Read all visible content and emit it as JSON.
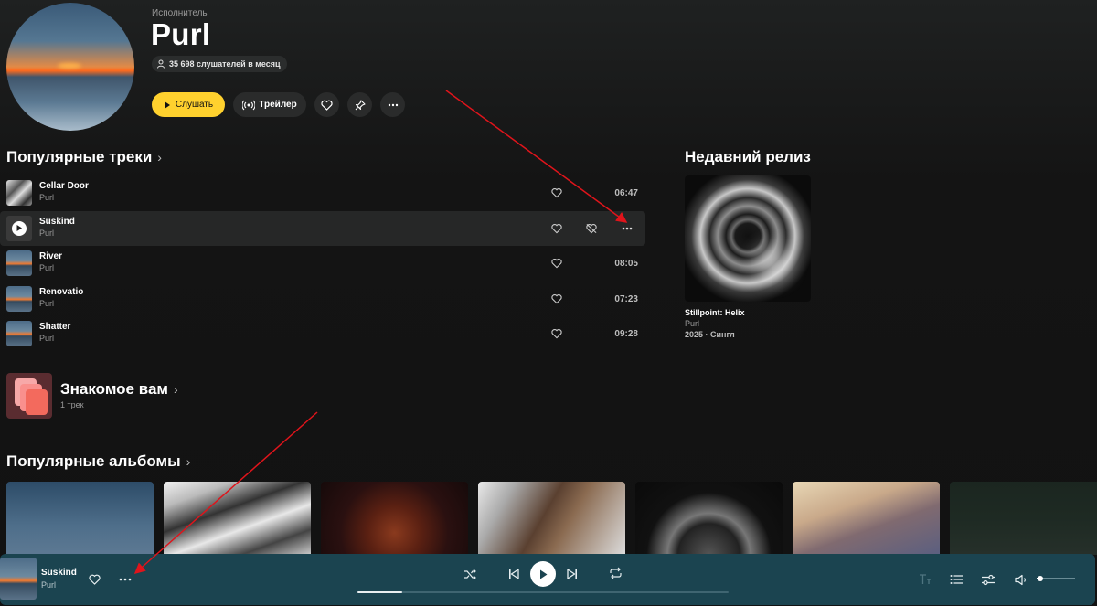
{
  "artist": {
    "kind": "Исполнитель",
    "name": "Purl",
    "listeners": "35 698 слушателей в месяц"
  },
  "actions": {
    "listen_label": "Слушать",
    "trailer_label": "Трейлер"
  },
  "popular_tracks": {
    "title": "Популярные треки",
    "items": [
      {
        "title": "Cellar Door",
        "artist": "Purl",
        "duration": "06:47"
      },
      {
        "title": "Suskind",
        "artist": "Purl",
        "duration": ""
      },
      {
        "title": "River",
        "artist": "Purl",
        "duration": "08:05"
      },
      {
        "title": "Renovatio",
        "artist": "Purl",
        "duration": "07:23"
      },
      {
        "title": "Shatter",
        "artist": "Purl",
        "duration": "09:28"
      }
    ]
  },
  "recent_release": {
    "title": "Недавний релиз",
    "name": "Stillpoint: Helix",
    "artist": "Purl",
    "meta": "2025 · Сингл"
  },
  "familiar": {
    "title": "Знакомое вам",
    "subtitle": "1 трек"
  },
  "popular_albums": {
    "title": "Популярные альбомы"
  },
  "player": {
    "title": "Suskind",
    "artist": "Purl",
    "progress_fraction": 0.12,
    "volume_fraction": 0.1
  },
  "colors": {
    "accent": "#ffd12e",
    "player_bg": "#1b4450",
    "annotation_arrow": "#e0141b"
  }
}
